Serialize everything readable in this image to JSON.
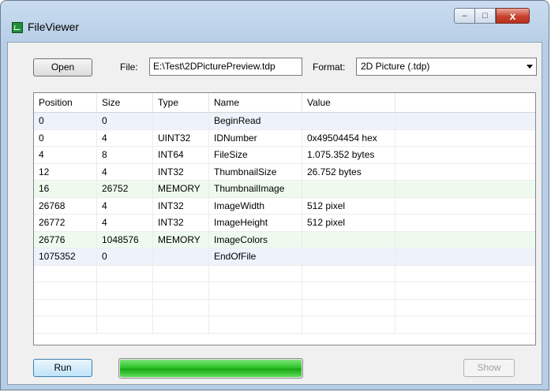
{
  "window": {
    "title": "FileViewer"
  },
  "titlebar_buttons": {
    "minimize": "–",
    "maximize": "□",
    "close": "x"
  },
  "toolbar": {
    "open_label": "Open",
    "file_label": "File:",
    "file_value": "E:\\Test\\2DPicturePreview.tdp",
    "format_label": "Format:",
    "format_value": "2D Picture (.tdp)"
  },
  "table": {
    "columns": [
      "Position",
      "Size",
      "Type",
      "Name",
      "Value",
      ""
    ],
    "rows": [
      {
        "position": "0",
        "size": "0",
        "type": "",
        "name": "BeginRead",
        "value": "",
        "tint": "#eef3fb"
      },
      {
        "position": "0",
        "size": "4",
        "type": "UINT32",
        "name": "IDNumber",
        "value": "0x49504454 hex",
        "tint": "#ffffff"
      },
      {
        "position": "4",
        "size": "8",
        "type": "INT64",
        "name": "FileSize",
        "value": "1.075.352 bytes",
        "tint": "#ffffff"
      },
      {
        "position": "12",
        "size": "4",
        "type": "INT32",
        "name": "ThumbnailSize",
        "value": "26.752 bytes",
        "tint": "#ffffff"
      },
      {
        "position": "16",
        "size": "26752",
        "type": "MEMORY",
        "name": "ThumbnailImage",
        "value": "",
        "tint": "#eefaee"
      },
      {
        "position": "26768",
        "size": "4",
        "type": "INT32",
        "name": "ImageWidth",
        "value": "512 pixel",
        "tint": "#ffffff"
      },
      {
        "position": "26772",
        "size": "4",
        "type": "INT32",
        "name": "ImageHeight",
        "value": "512 pixel",
        "tint": "#ffffff"
      },
      {
        "position": "26776",
        "size": "1048576",
        "type": "MEMORY",
        "name": "ImageColors",
        "value": "",
        "tint": "#eefaee"
      },
      {
        "position": "1075352",
        "size": "0",
        "type": "",
        "name": "EndOfFile",
        "value": "",
        "tint": "#eef3fb"
      },
      {
        "position": "",
        "size": "",
        "type": "",
        "name": "",
        "value": "",
        "tint": "#ffffff"
      },
      {
        "position": "",
        "size": "",
        "type": "",
        "name": "",
        "value": "",
        "tint": "#ffffff"
      },
      {
        "position": "",
        "size": "",
        "type": "",
        "name": "",
        "value": "",
        "tint": "#ffffff"
      },
      {
        "position": "",
        "size": "",
        "type": "",
        "name": "",
        "value": "",
        "tint": "#ffffff"
      }
    ]
  },
  "footer": {
    "run_label": "Run",
    "show_label": "Show",
    "progress_fraction": 1.0
  }
}
